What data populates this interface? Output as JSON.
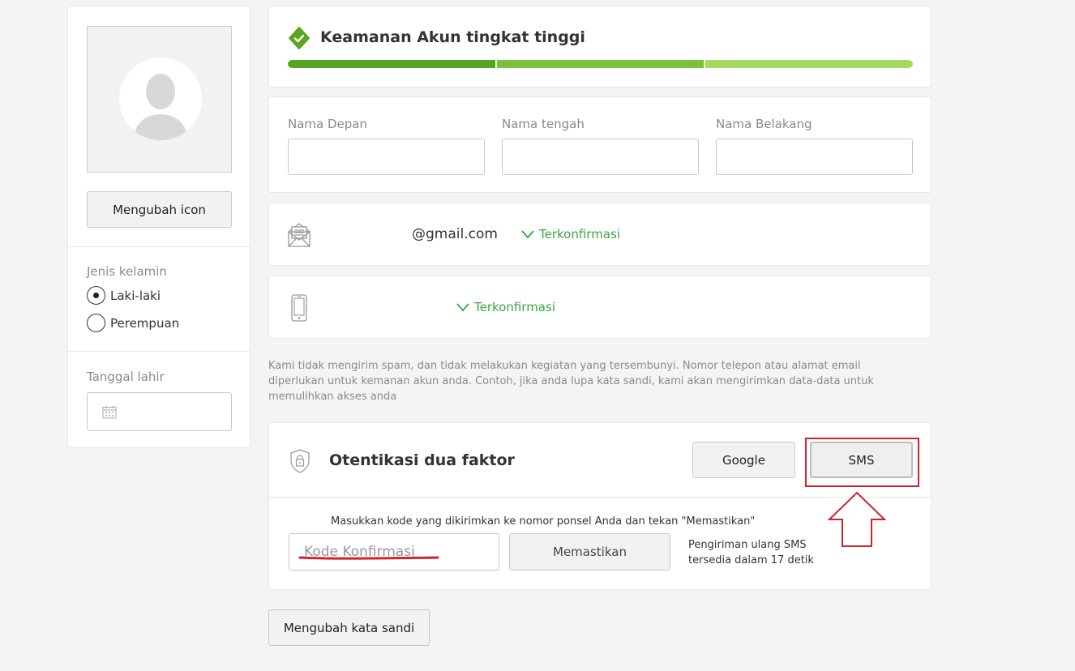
{
  "profile": {
    "change_icon_label": "Mengubah icon",
    "gender_label": "Jenis kelamin",
    "gender_options": [
      "Laki-laki",
      "Perempuan"
    ],
    "gender_selected": "Laki-laki",
    "birthdate_label": "Tanggal lahir"
  },
  "security": {
    "title": "Keamanan Akun tingkat tinggi",
    "segments_filled": 3,
    "segments_total": 3,
    "colors": {
      "segment_1": "#5aa520",
      "segment_2": "#7cc13a",
      "segment_3": "#a4d85e",
      "accent": "#5aa520"
    },
    "icon": "shield-check-icon"
  },
  "names": {
    "first_label": "Nama Depan",
    "middle_label": "Nama tengah",
    "last_label": "Nama Belakang"
  },
  "email": {
    "icon": "envelope-icon",
    "value": "@gmail.com",
    "status": "Terkonfirmasi"
  },
  "phone": {
    "icon": "mobile-phone-icon",
    "status": "Terkonfirmasi"
  },
  "notice": "Kami tidak mengirim spam, dan tidak melakukan kegiatan yang tersembunyi. Nomor telepon atau alamat email diperlukan untuk kemanan akun anda. Contoh, jika anda lupa kata sandi, kami akan mengirimkan data-data untuk memulihkan akses anda",
  "twofa": {
    "icon": "shield-lock-icon",
    "title": "Otentikasi dua faktor",
    "google_label": "Google",
    "sms_label": "SMS",
    "instruction": "Masukkan kode yang dikirimkan ke nomor ponsel Anda dan tekan \"Memastikan\"",
    "code_placeholder": "Kode Konfirmasi",
    "confirm_label": "Memastikan",
    "resend_line1": "Pengiriman ulang SMS",
    "resend_line2": "tersedia dalam 17 detik"
  },
  "change_password_label": "Mengubah kata sandi",
  "colors": {
    "confirmed": "#3aa645",
    "annotation": "#d2232a"
  }
}
